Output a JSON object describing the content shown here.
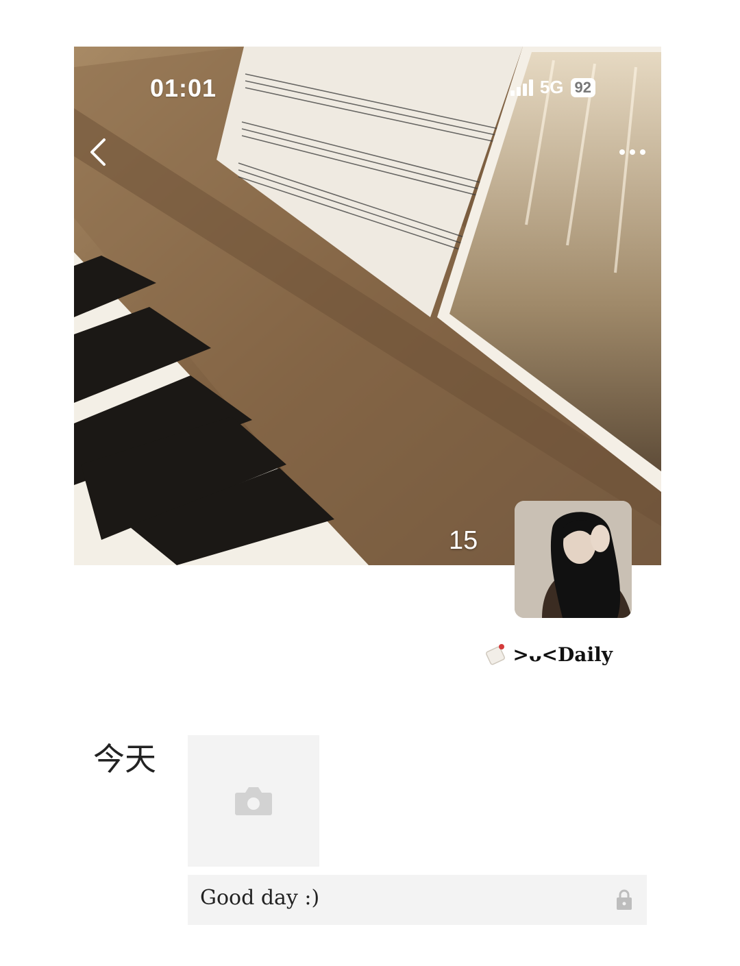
{
  "status_bar": {
    "time": "01:01",
    "network": "5G",
    "battery": "92"
  },
  "cover": {
    "count": "15",
    "back_icon": "chevron-left-icon",
    "more_icon": "more-dots-icon"
  },
  "profile": {
    "name": ">ᴗ<Daily",
    "sticker_icon": "tag-sticker-icon"
  },
  "feed": {
    "day_label": "今天",
    "posts": [
      {
        "text": "Good day :)",
        "visibility_icon": "lock-icon",
        "photo_icon": "camera-icon"
      }
    ]
  },
  "colors": {
    "background": "#ffffff",
    "placeholder": "#f3f3f3",
    "placeholder_icon": "#d2d2d2"
  }
}
